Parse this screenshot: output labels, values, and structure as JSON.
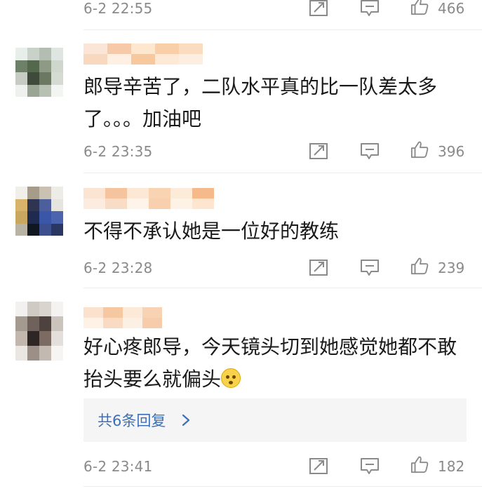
{
  "comments": [
    {
      "time": "6-2 22:55",
      "likes": "466",
      "text": ""
    },
    {
      "time": "6-2 23:35",
      "likes": "396",
      "text": "郎导辛苦了，二队水平真的比一队差太多\n了。。。加油吧"
    },
    {
      "time": "6-2 23:28",
      "likes": "239",
      "text": "不得不承认她是一位好的教练"
    },
    {
      "time": "6-2 23:41",
      "likes": "182",
      "text": "好心疼郎导，今天镜头切到她感觉她都不敢\n抬头要么就偏头"
    }
  ],
  "replies": {
    "label": "共6条回复"
  },
  "icons": {
    "repost": "repost-icon",
    "comment": "comment-icon",
    "like": "thumbs-up-icon",
    "chevron": "chevron-right-icon",
    "emoji": "flushed-face-emoji"
  },
  "colors": {
    "meta_text": "#8a8a8a",
    "link": "#3d6fb6",
    "reply_bg": "#f5f5f5",
    "divider": "#ececec"
  }
}
